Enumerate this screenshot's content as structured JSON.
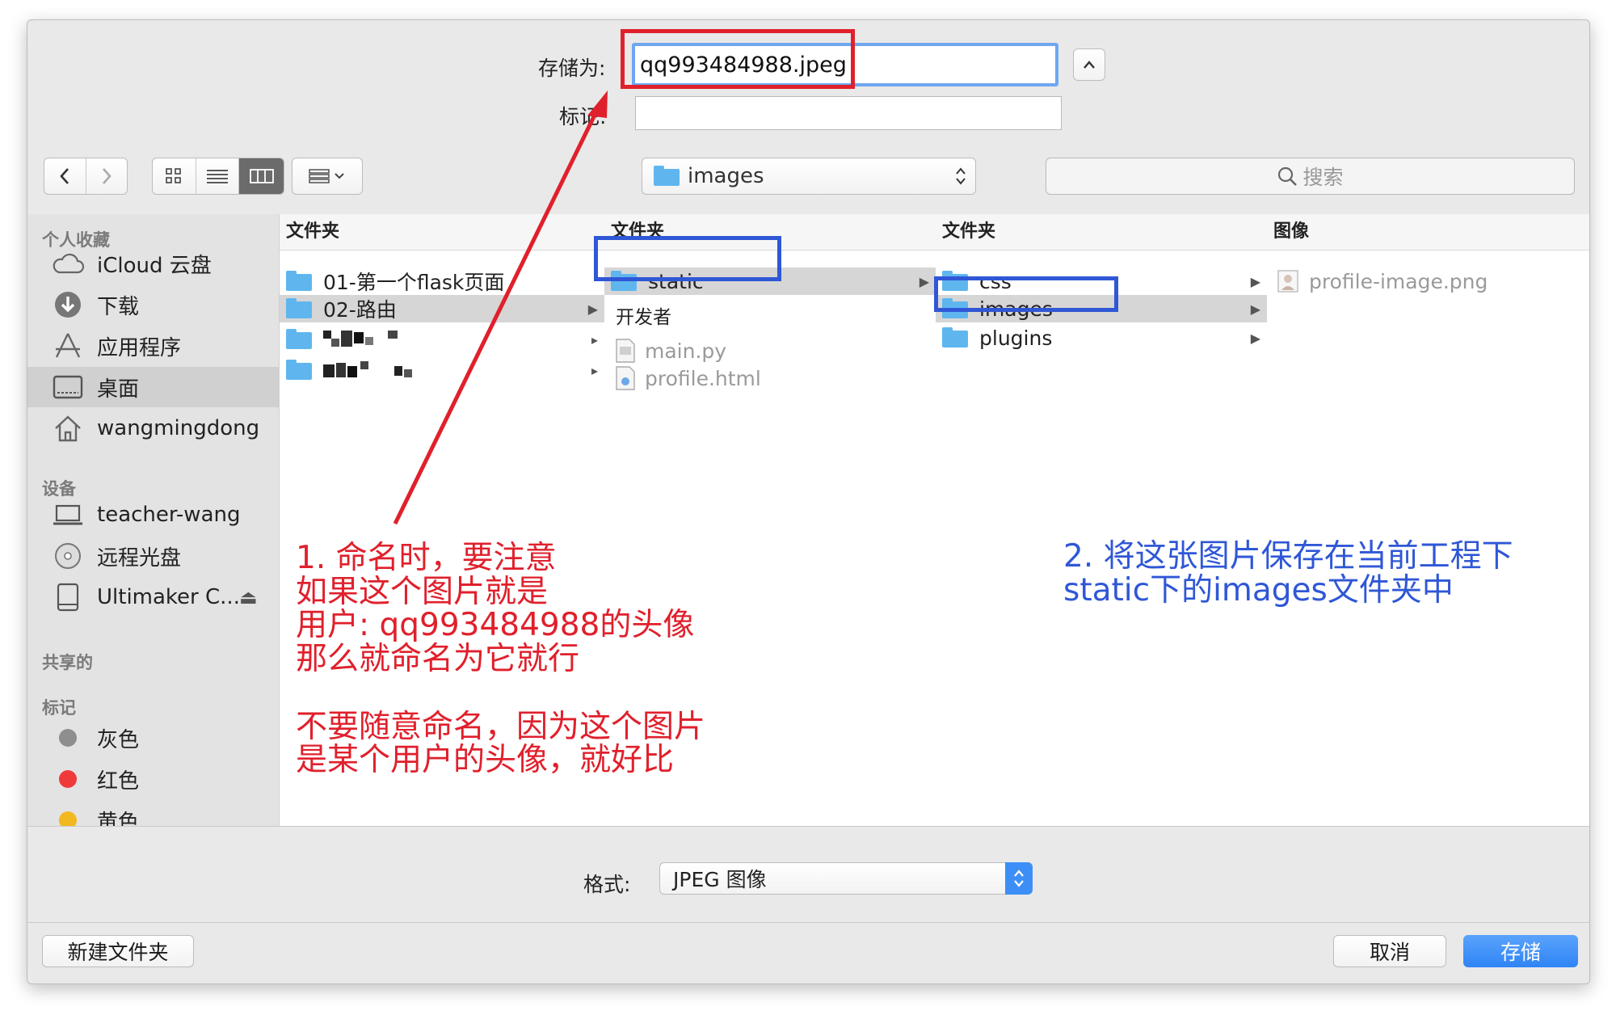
{
  "save_as": {
    "label": "存储为:",
    "value": "qq993484988.jpeg"
  },
  "tags": {
    "label": "标记:",
    "value": ""
  },
  "toolbar": {
    "back": "‹",
    "forward": "›",
    "view_icon": "☷",
    "location": "images",
    "search_placeholder": "搜索"
  },
  "sidebar": {
    "favorites_header": "个人收藏",
    "favorites": [
      {
        "label": "iCloud 云盘",
        "icon": "cloud-icon"
      },
      {
        "label": "下载",
        "icon": "download-icon"
      },
      {
        "label": "应用程序",
        "icon": "applications-icon"
      },
      {
        "label": "桌面",
        "icon": "desktop-icon"
      },
      {
        "label": "wangmingdong",
        "icon": "home-icon"
      }
    ],
    "devices_header": "设备",
    "devices": [
      {
        "label": "teacher-wang",
        "icon": "laptop-icon"
      },
      {
        "label": "远程光盘",
        "icon": "disc-icon"
      },
      {
        "label": "Ultimaker C...",
        "icon": "drive-icon",
        "eject": "⏏"
      }
    ],
    "shared_header": "共享的",
    "tags_header": "标记",
    "tags": [
      {
        "label": "灰色",
        "color": "#8e8e8e"
      },
      {
        "label": "红色",
        "color": "#f0393b"
      },
      {
        "label": "黄色",
        "color": "#f2b81f"
      }
    ]
  },
  "columns": [
    {
      "header": "文件夹",
      "items": [
        {
          "label": "01-第一个flask页面"
        },
        {
          "label": "02-路由"
        }
      ]
    },
    {
      "header": "文件夹",
      "items": [
        {
          "label": "static"
        }
      ],
      "section2_header": "开发者",
      "files": [
        {
          "label": "main.py"
        },
        {
          "label": "profile.html"
        }
      ]
    },
    {
      "header": "文件夹",
      "items": [
        {
          "label": "css"
        },
        {
          "label": "images"
        },
        {
          "label": "plugins"
        }
      ]
    },
    {
      "header": "图像",
      "files": [
        {
          "label": "profile-image.png"
        }
      ]
    }
  ],
  "format": {
    "label": "格式:",
    "value": "JPEG 图像"
  },
  "buttons": {
    "new_folder": "新建文件夹",
    "cancel": "取消",
    "save": "存储"
  },
  "annotations": {
    "note1": "1. 命名时，要注意\n如果这个图片就是\n用户: qq993484988的头像\n那么就命名为它就行\n\n不要随意命名，因为这个图片\n是某个用户的头像，就好比",
    "note2": "2. 将这张图片保存在当前工程下\nstatic下的images文件夹中"
  },
  "colors": {
    "accent": "#3d8ff7",
    "annotation_red": "#e0202c",
    "annotation_blue": "#2f57d6"
  }
}
